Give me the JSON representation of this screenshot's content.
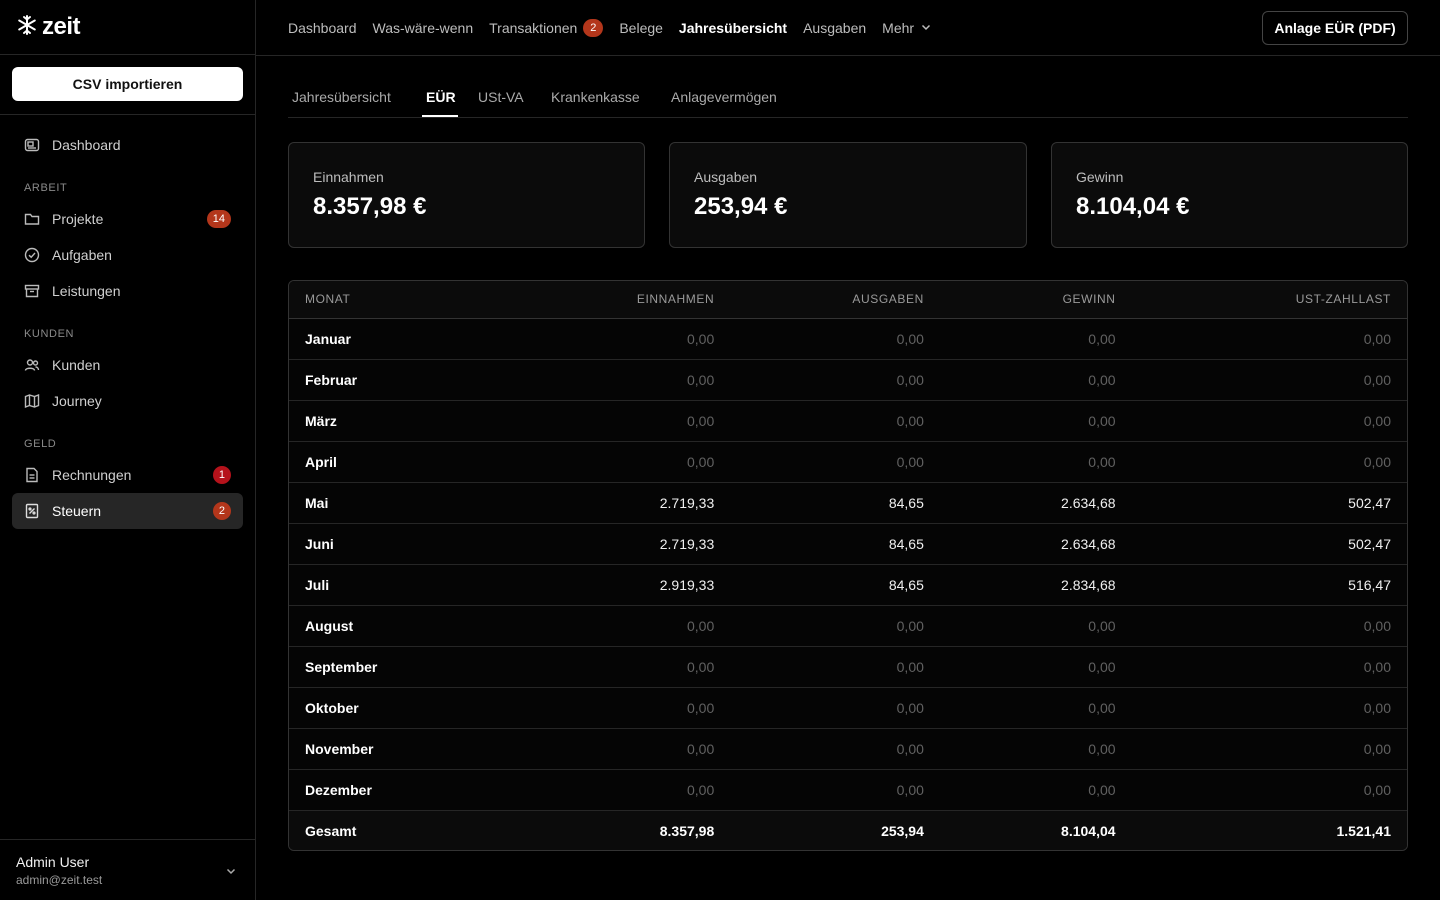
{
  "brand": {
    "name": "zeit"
  },
  "sidebar": {
    "csv_button": "CSV importieren",
    "dashboard": "Dashboard",
    "sections": {
      "arbeit": "ARBEIT",
      "kunden": "KUNDEN",
      "geld": "GELD"
    },
    "items": {
      "projekte": {
        "label": "Projekte",
        "badge": "14"
      },
      "aufgaben": {
        "label": "Aufgaben"
      },
      "leistungen": {
        "label": "Leistungen"
      },
      "kunden": {
        "label": "Kunden"
      },
      "journey": {
        "label": "Journey"
      },
      "rechnungen": {
        "label": "Rechnungen",
        "badge": "1"
      },
      "steuern": {
        "label": "Steuern",
        "badge": "2"
      }
    },
    "user": {
      "name": "Admin User",
      "email": "admin@zeit.test"
    }
  },
  "topnav": {
    "items": [
      "Dashboard",
      "Was-wäre-wenn",
      "Transaktionen",
      "Belege",
      "Jahresübersicht",
      "Ausgaben",
      "Mehr"
    ],
    "transaktionen_badge": "2",
    "active": "Jahresübersicht",
    "pdf_button": "Anlage EÜR (PDF)"
  },
  "subtabs": {
    "items": [
      "Jahresübersicht",
      "EÜR",
      "USt-VA",
      "Krankenkasse",
      "Anlagevermögen"
    ],
    "active": "EÜR"
  },
  "cards": {
    "einnahmen": {
      "label": "Einnahmen",
      "value": "8.357,98 €"
    },
    "ausgaben": {
      "label": "Ausgaben",
      "value": "253,94 €"
    },
    "gewinn": {
      "label": "Gewinn",
      "value": "8.104,04 €"
    }
  },
  "table": {
    "headers": [
      "MONAT",
      "EINNAHMEN",
      "AUSGABEN",
      "GEWINN",
      "UST-ZAHLLAST"
    ],
    "rows": [
      [
        "Januar",
        "0,00",
        "0,00",
        "0,00",
        "0,00"
      ],
      [
        "Februar",
        "0,00",
        "0,00",
        "0,00",
        "0,00"
      ],
      [
        "März",
        "0,00",
        "0,00",
        "0,00",
        "0,00"
      ],
      [
        "April",
        "0,00",
        "0,00",
        "0,00",
        "0,00"
      ],
      [
        "Mai",
        "2.719,33",
        "84,65",
        "2.634,68",
        "502,47"
      ],
      [
        "Juni",
        "2.719,33",
        "84,65",
        "2.634,68",
        "502,47"
      ],
      [
        "Juli",
        "2.919,33",
        "84,65",
        "2.834,68",
        "516,47"
      ],
      [
        "August",
        "0,00",
        "0,00",
        "0,00",
        "0,00"
      ],
      [
        "September",
        "0,00",
        "0,00",
        "0,00",
        "0,00"
      ],
      [
        "Oktober",
        "0,00",
        "0,00",
        "0,00",
        "0,00"
      ],
      [
        "November",
        "0,00",
        "0,00",
        "0,00",
        "0,00"
      ],
      [
        "Dezember",
        "0,00",
        "0,00",
        "0,00",
        "0,00"
      ]
    ],
    "total": [
      "Gesamt",
      "8.357,98",
      "253,94",
      "8.104,04",
      "1.521,41"
    ]
  },
  "colors": {
    "accent_badge": "#b3361b",
    "alert_badge": "#b5121b",
    "background": "#000000",
    "border": "#262626"
  }
}
